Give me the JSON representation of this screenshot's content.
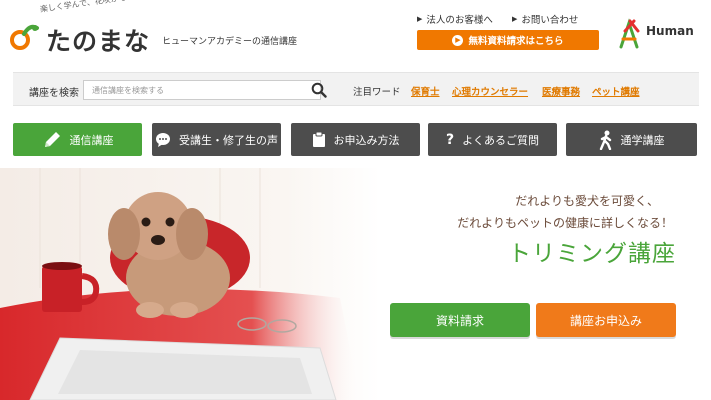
{
  "header": {
    "tagline": "楽しく学んで、花咲かそう。",
    "logo_text": "たのまな",
    "subtitle": "ヒューマンアカデミーの通信講座",
    "corporate_link": "法人のお客様へ",
    "contact_link": "お問い合わせ",
    "free_request": "無料資料請求はこちら",
    "human_brand": "Human"
  },
  "search": {
    "label": "講座を検索",
    "placeholder": "通信講座を検索する",
    "keyword_label": "注目ワード",
    "keywords": [
      "保育士",
      "心理カウンセラー",
      "医療事務",
      "ペット講座"
    ]
  },
  "nav": {
    "items": [
      {
        "label": "通信講座",
        "icon": "pencil-icon"
      },
      {
        "label": "受講生・修了生の声",
        "icon": "speech-bubble-icon"
      },
      {
        "label": "お申込み方法",
        "icon": "clipboard-icon"
      },
      {
        "label": "よくあるご質問",
        "icon": "question-icon"
      },
      {
        "label": "通学講座",
        "icon": "walking-person-icon"
      }
    ]
  },
  "hero": {
    "line1": "だれよりも愛犬を可愛く、",
    "line2": "だれよりもペットの健康に詳しくなる！",
    "title": "トリミング講座",
    "request_button": "資料請求",
    "apply_button": "講座お申込み"
  },
  "colors": {
    "accent_green": "#4aa53a",
    "accent_orange": "#f07800",
    "nav_dark": "#4d4d4d",
    "keyword_orange": "#e07a00"
  }
}
